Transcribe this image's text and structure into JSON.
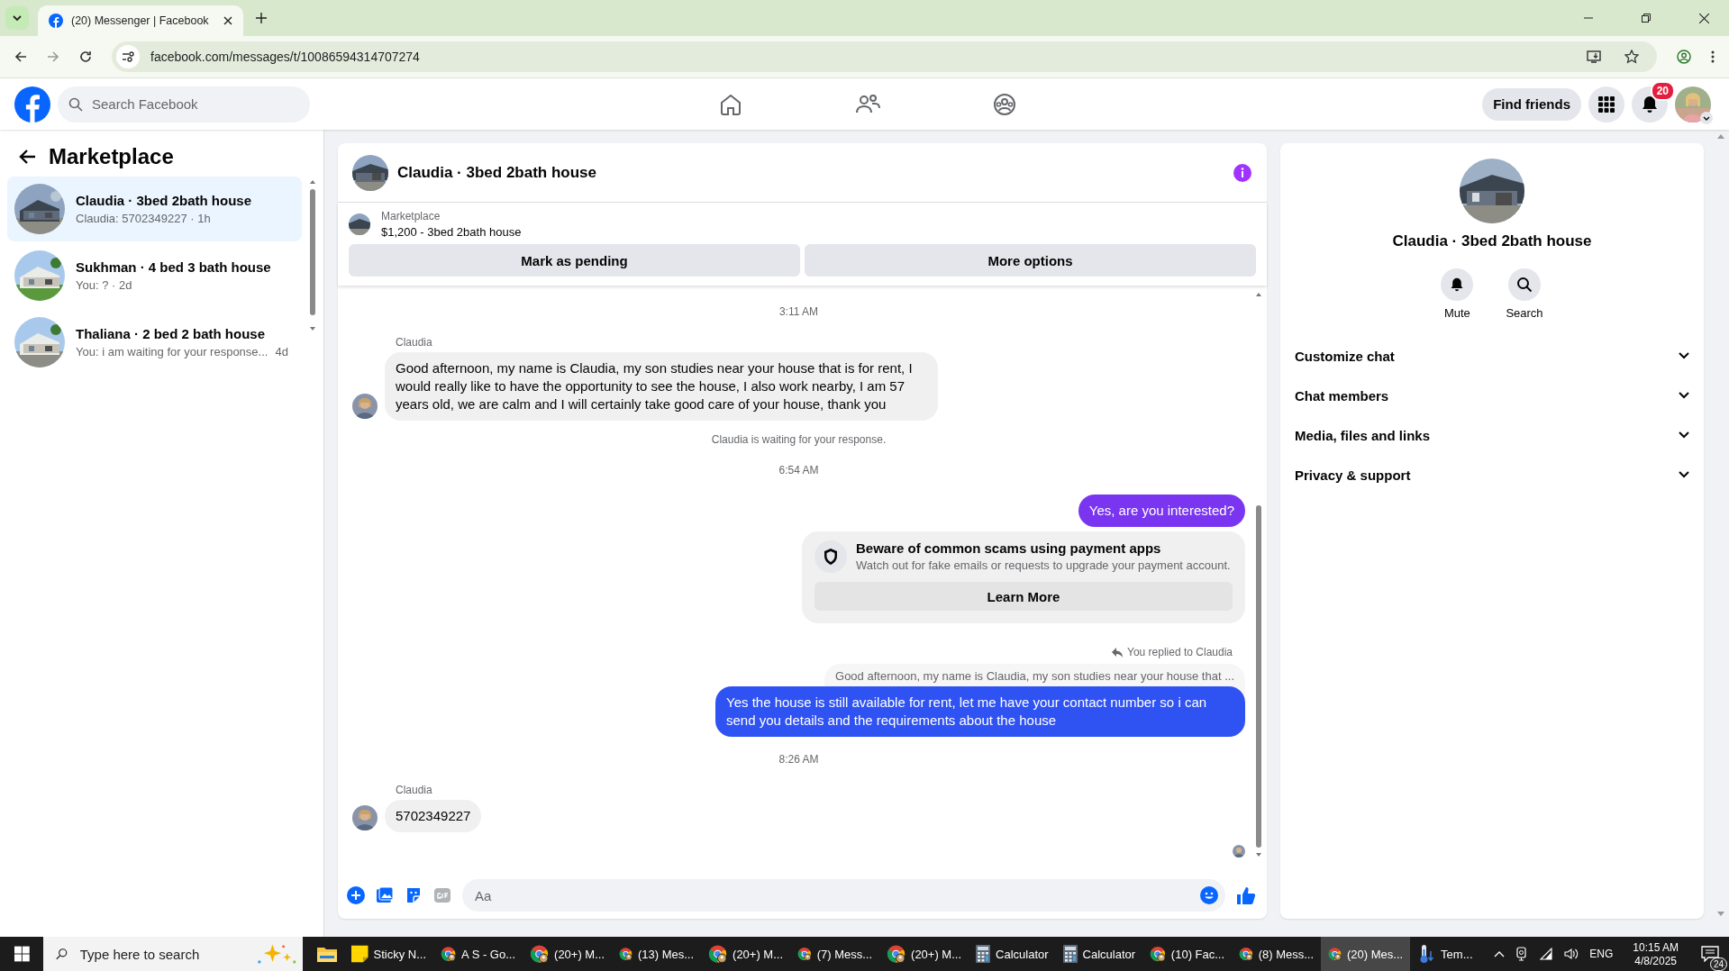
{
  "browser": {
    "tab_title": "(20) Messenger | Facebook",
    "url": "facebook.com/messages/t/10086594314707274"
  },
  "header": {
    "search_placeholder": "Search Facebook",
    "find_friends": "Find friends",
    "notification_count": "20"
  },
  "sidebar": {
    "title": "Marketplace",
    "conversations": [
      {
        "name": "Claudia · 3bed 2bath house",
        "preview": "Claudia: 5702349227 · 1h",
        "selected": true
      },
      {
        "name": "Sukhman · 4 bed 3 bath house",
        "preview": "You: ? · 2d",
        "selected": false
      },
      {
        "name": "Thaliana · 2 bed 2 bath house",
        "preview": "You: i am waiting for your response...",
        "time": "4d",
        "selected": false
      }
    ]
  },
  "chat": {
    "title": "Claudia · 3bed 2bath house",
    "listing_label": "Marketplace",
    "listing": "$1,200 - 3bed 2bath house",
    "actions": [
      "Mark as pending",
      "More options"
    ],
    "messages": [
      {
        "kind": "time",
        "text": "3:11 AM"
      },
      {
        "kind": "incoming",
        "sender": "Claudia",
        "text": "Good afternoon, my name is Claudia, my son studies near your house that is for rent, I would really like to have the opportunity to see the house, I also work nearby, I am 57 years old, we are calm and I will certainly take good care of your house, thank you"
      },
      {
        "kind": "notice",
        "text": "Claudia is waiting for your response."
      },
      {
        "kind": "time",
        "text": "6:54 AM"
      },
      {
        "kind": "outgoing",
        "text": "Yes, are you interested?",
        "color": "#7a35f0"
      },
      {
        "kind": "warning",
        "title": "Beware of common scams using payment apps",
        "body": "Watch out for fake emails or requests to upgrade your payment account.",
        "button": "Learn More"
      },
      {
        "kind": "reply",
        "label": "You replied to Claudia",
        "quote": "Good afternoon, my name is Claudia, my son studies near your house that ...",
        "text": "Yes the house is still available for rent, let me have your contact number so i can send you details and the requirements about the house",
        "color": "#2f52f2"
      },
      {
        "kind": "time",
        "text": "8:26 AM"
      },
      {
        "kind": "incoming",
        "sender": "Claudia",
        "text": "5702349227"
      },
      {
        "kind": "seen"
      }
    ],
    "composer_placeholder": "Aa"
  },
  "profile": {
    "name": "Claudia · 3bed 2bath house",
    "actions": [
      {
        "kind": "bell",
        "label": "Mute"
      },
      {
        "kind": "search",
        "label": "Search"
      }
    ],
    "sections": [
      {
        "label": "Customize chat",
        "expanded": false
      },
      {
        "label": "Chat members",
        "expanded": false
      },
      {
        "label": "Media, files and links",
        "expanded": false
      },
      {
        "label": "Privacy & support",
        "expanded": false
      }
    ]
  },
  "taskbar": {
    "search_placeholder": "Type here to search",
    "apps": [
      {
        "kind": "explorer",
        "selected": false
      },
      {
        "kind": "sticky",
        "label": "Sticky N...",
        "selected": false
      },
      {
        "kind": "chrome",
        "label": "A S - Go...",
        "selected": false
      },
      {
        "kind": "chrome",
        "label": "(20+) M...",
        "selected": false
      },
      {
        "kind": "chrome",
        "label": "(13) Mes...",
        "selected": false
      },
      {
        "kind": "chrome",
        "label": "(20+) M...",
        "selected": false
      },
      {
        "kind": "chrome",
        "label": "(7) Mess...",
        "selected": false
      },
      {
        "kind": "chrome",
        "label": "(20+) M...",
        "selected": false
      },
      {
        "kind": "calculator",
        "label": "Calculator",
        "selected": false
      },
      {
        "kind": "calculator",
        "label": "Calculator",
        "selected": false
      },
      {
        "kind": "chrome",
        "label": "(10) Fac...",
        "selected": false
      },
      {
        "kind": "chrome",
        "label": "(8) Mess...",
        "selected": false
      },
      {
        "kind": "chrome",
        "label": "(20) Mes...",
        "selected": true
      },
      {
        "kind": "weather",
        "label": "Tem...",
        "selected": false
      }
    ],
    "language": "ENG",
    "time": "10:15 AM",
    "date": "4/8/2025",
    "notifications": "24"
  }
}
